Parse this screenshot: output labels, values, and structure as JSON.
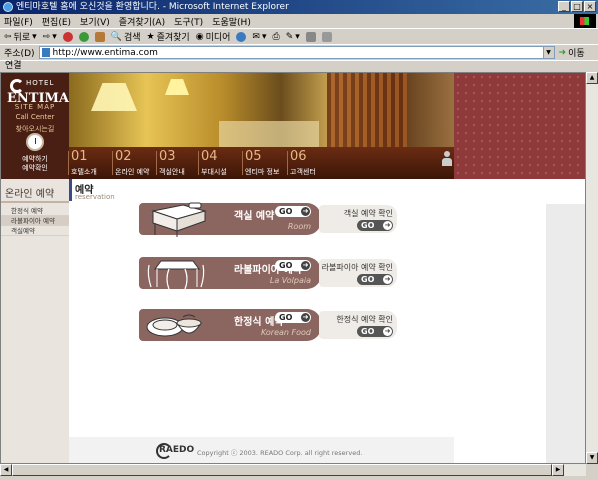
{
  "window": {
    "title": "엔티마호텔 홈에 오신것을 환영합니다. - Microsoft Internet Explorer",
    "controls": [
      "_",
      "□",
      "×"
    ]
  },
  "menubar": {
    "items": [
      "파일(F)",
      "편집(E)",
      "보기(V)",
      "즐겨찾기(A)",
      "도구(T)",
      "도움말(H)"
    ]
  },
  "toolbar": {
    "back": "뒤로",
    "search": "검색",
    "favorites": "즐겨찾기",
    "media": "미디어"
  },
  "addressbar": {
    "label": "주소(D)",
    "url": "http://www.entima.com",
    "go": "이동"
  },
  "linkbar": {
    "label": "연결"
  },
  "site": {
    "logo_hotel": "HOTEL",
    "logo_name": "ENTIMA",
    "sitemap": "SITE MAP",
    "callcenter": "Call Center",
    "findus": "찾아오시는길",
    "reserve_links": [
      "예약하기",
      "예약확인"
    ],
    "nav": [
      {
        "num": "01",
        "label": "호텔소개"
      },
      {
        "num": "02",
        "label": "온라인 예약"
      },
      {
        "num": "03",
        "label": "객실안내"
      },
      {
        "num": "04",
        "label": "부대시설"
      },
      {
        "num": "05",
        "label": "엔티마 정보"
      },
      {
        "num": "06",
        "label": "고객센터"
      }
    ],
    "sidebar": {
      "title": "온라인 예약",
      "items": [
        "한정식 예약",
        "라볼파이아 예약",
        "객실예약"
      ]
    },
    "page": {
      "title": "예약",
      "subtitle": "reservation"
    },
    "cards": [
      {
        "ko": "객실 예약",
        "en": "Room",
        "confirm": "객실 예약 확인"
      },
      {
        "ko": "라볼파이아 예약",
        "en": "La Volpaia",
        "confirm": "라볼파이아 예약 확인"
      },
      {
        "ko": "한정식 예약",
        "en": "Korean Food",
        "confirm": "한정식 예약 확인"
      }
    ],
    "go_label": "GO",
    "footer": {
      "logo": "RAEDO",
      "copyright": "Copyright ⓒ 2003. READO Corp. all right reserved."
    }
  },
  "colors": {
    "brand_dark": "#4a1f13",
    "card": "#8b6660",
    "dots_panel": "#8e3a3a"
  }
}
